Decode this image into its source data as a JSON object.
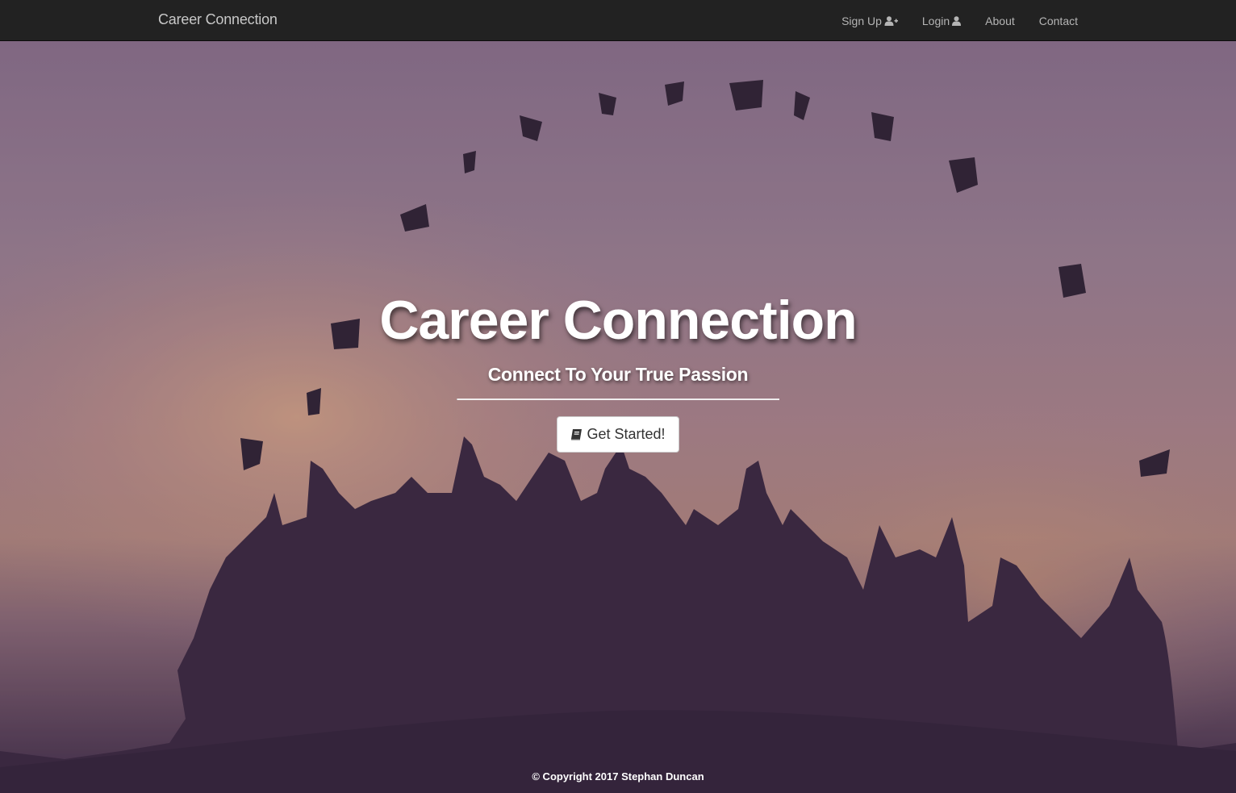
{
  "navbar": {
    "brand": "Career Connection",
    "links": [
      {
        "label": "Sign Up",
        "icon": "user-plus-icon"
      },
      {
        "label": "Login",
        "icon": "user-icon"
      },
      {
        "label": "About"
      },
      {
        "label": "Contact"
      }
    ]
  },
  "hero": {
    "title": "Career Connection",
    "subtitle": "Connect To Your True Passion",
    "cta_label": "Get Started!",
    "cta_icon": "book-icon",
    "background": "graduation-silhouette-sunset-photo"
  },
  "footer": {
    "copyright": "© Copyright 2017 Stephan Duncan"
  },
  "colors": {
    "navbar_bg": "#222222",
    "nav_text": "#b5b5b5",
    "hero_text": "#ffffff",
    "button_bg": "#ffffff",
    "button_text": "#333333"
  }
}
